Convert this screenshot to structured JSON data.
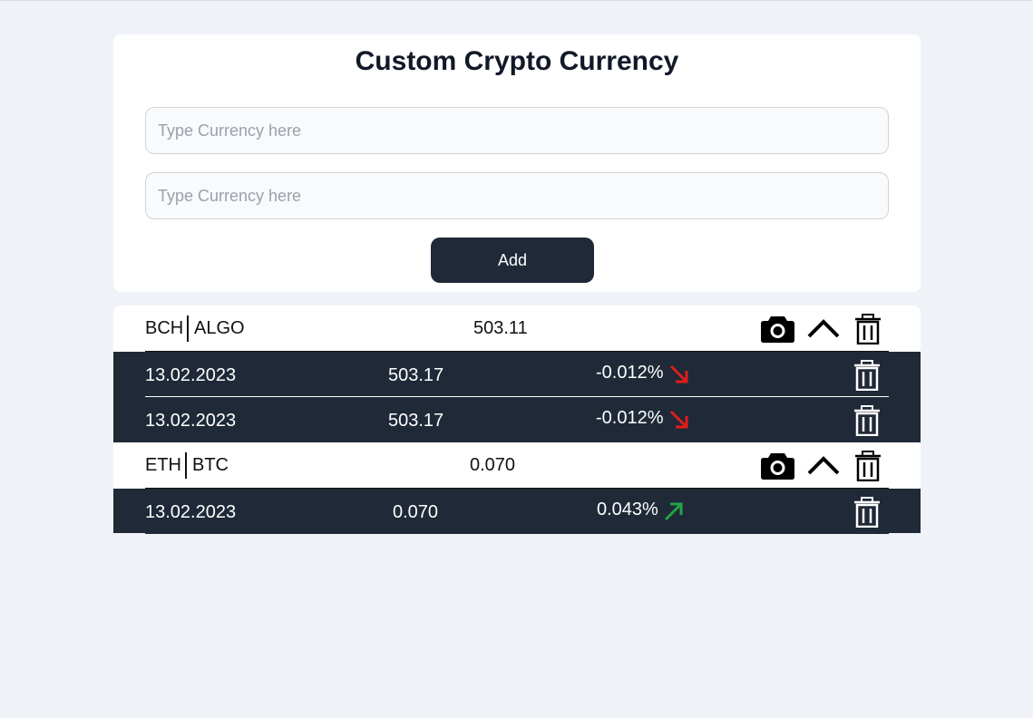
{
  "form": {
    "title": "Custom Crypto Currency",
    "input1_placeholder": "Type Currency here",
    "input2_placeholder": "Type Currency here",
    "add_label": "Add"
  },
  "pairs": [
    {
      "base": "BCH",
      "quote": "ALGO",
      "price": "503.11",
      "history": [
        {
          "date": "13.02.2023",
          "value": "503.17",
          "change": "-0.012%",
          "trend": "down",
          "color": "#e11d1d"
        },
        {
          "date": "13.02.2023",
          "value": "503.17",
          "change": "-0.012%",
          "trend": "down",
          "color": "#e11d1d"
        }
      ]
    },
    {
      "base": "ETH",
      "quote": "BTC",
      "price": "0.070",
      "history": [
        {
          "date": "13.02.2023",
          "value": "0.070",
          "change": "0.043%",
          "trend": "up",
          "color": "#22a447"
        }
      ]
    }
  ],
  "icons": {
    "snapshot": "camera-icon",
    "collapse": "chevron-up-icon",
    "delete": "trash-icon",
    "down": "arrow-down-right-icon",
    "up": "arrow-up-right-icon"
  }
}
